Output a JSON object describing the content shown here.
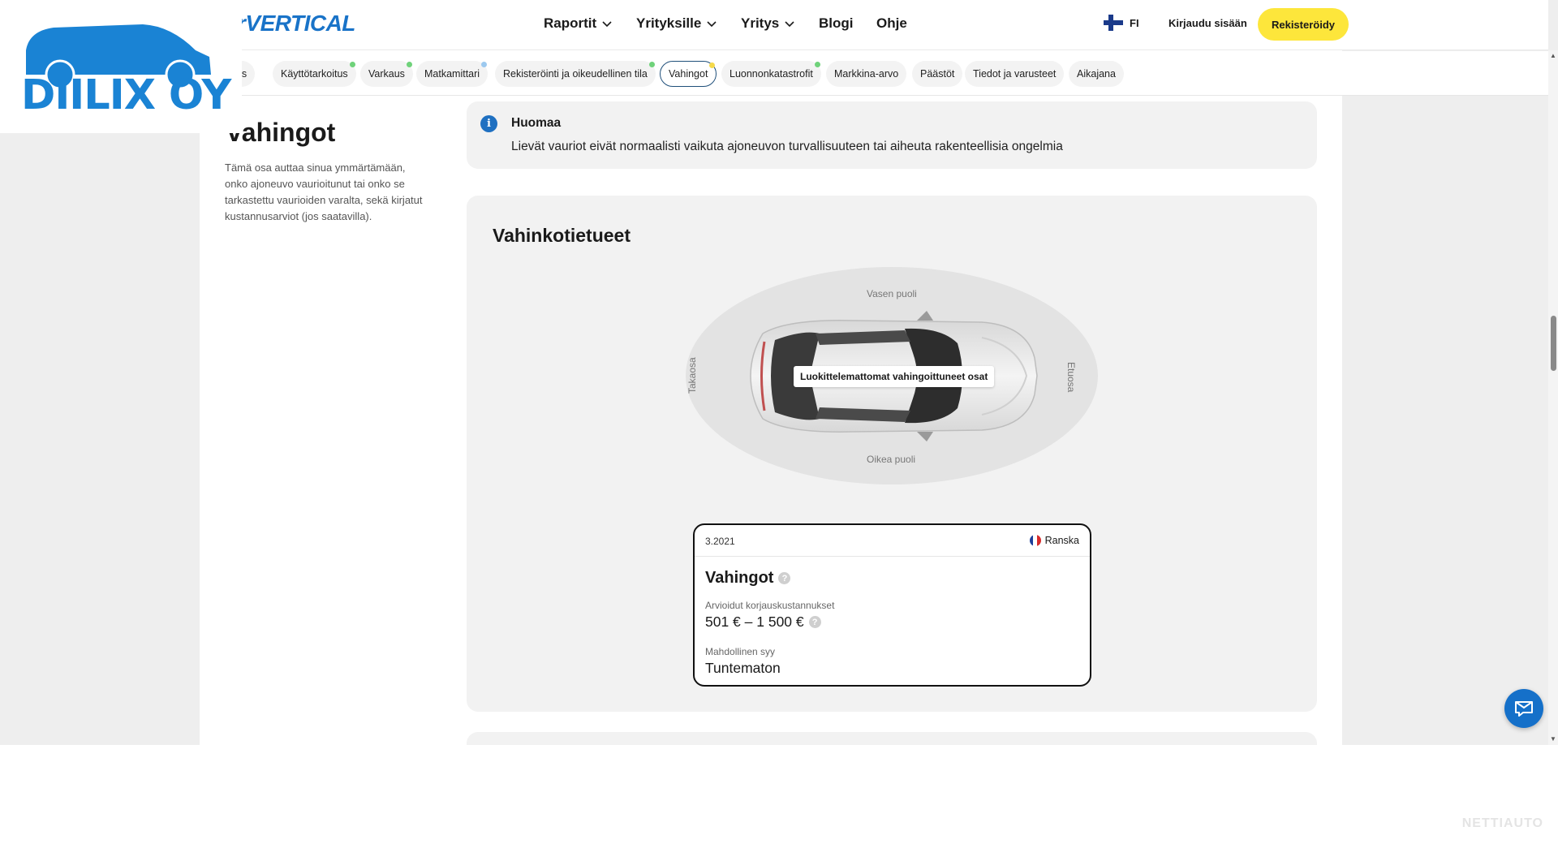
{
  "header": {
    "brand": "rVERTICAL",
    "nav": [
      {
        "label": "Raportit",
        "has_menu": true
      },
      {
        "label": "Yrityksille",
        "has_menu": true
      },
      {
        "label": "Yritys",
        "has_menu": true
      },
      {
        "label": "Blogi",
        "has_menu": false
      },
      {
        "label": "Ohje",
        "has_menu": false
      }
    ],
    "language": "FI",
    "login": "Kirjaudu sisään",
    "register": "Rekisteröidy"
  },
  "tabs": [
    {
      "label": "aus",
      "dot": null
    },
    {
      "label": "Käyttötarkoitus",
      "dot": "#6fd27a"
    },
    {
      "label": "Varkaus",
      "dot": "#6fd27a"
    },
    {
      "label": "Matkamittari",
      "dot": "#9cc9ef"
    },
    {
      "label": "Rekisteröinti ja oikeudellinen tila",
      "dot": "#6fd27a"
    },
    {
      "label": "Vahingot",
      "dot": "#f5d94a",
      "active": true
    },
    {
      "label": "Luonnonkatastrofit",
      "dot": "#6fd27a"
    },
    {
      "label": "Markkina-arvo",
      "dot": null
    },
    {
      "label": "Päästöt",
      "dot": null
    },
    {
      "label": "Tiedot ja varusteet",
      "dot": null
    },
    {
      "label": "Aikajana",
      "dot": null
    }
  ],
  "section": {
    "title": "vahingot",
    "description": "Tämä osa auttaa sinua ymmärtämään, onko ajoneuvo vaurioitunut tai onko se tarkastettu vaurioiden varalta, sekä kirjatut kustannusarviot (jos saatavilla)."
  },
  "notice": {
    "title": "Huomaa",
    "text": "Lievät vauriot eivät normaalisti vaikuta ajoneuvon turvallisuuteen tai aiheuta rakenteellisia ongelmia"
  },
  "damage": {
    "title": "Vahinkotietueet",
    "labels": {
      "left": "Vasen puoli",
      "right": "Oikea puoli",
      "rear": "Takaosa",
      "front": "Etuosa"
    },
    "tooltip": "Luokittelemattomat vahingoittuneet osat",
    "record": {
      "date": "3.2021",
      "country": "Ranska",
      "heading": "Vahingot",
      "cost_label": "Arvioidut korjauskustannukset",
      "cost_value": "501 € – 1 500 €",
      "cause_label": "Mahdollinen syy",
      "cause_value": "Tuntematon"
    }
  },
  "logo": {
    "text": "DIILIX OY",
    "color": "#1a83d4"
  },
  "watermark": "NETTIAUTO",
  "colors": {
    "accent": "#1973c8",
    "register": "#fde63b",
    "active_tab_border": "#1f4f7a"
  }
}
